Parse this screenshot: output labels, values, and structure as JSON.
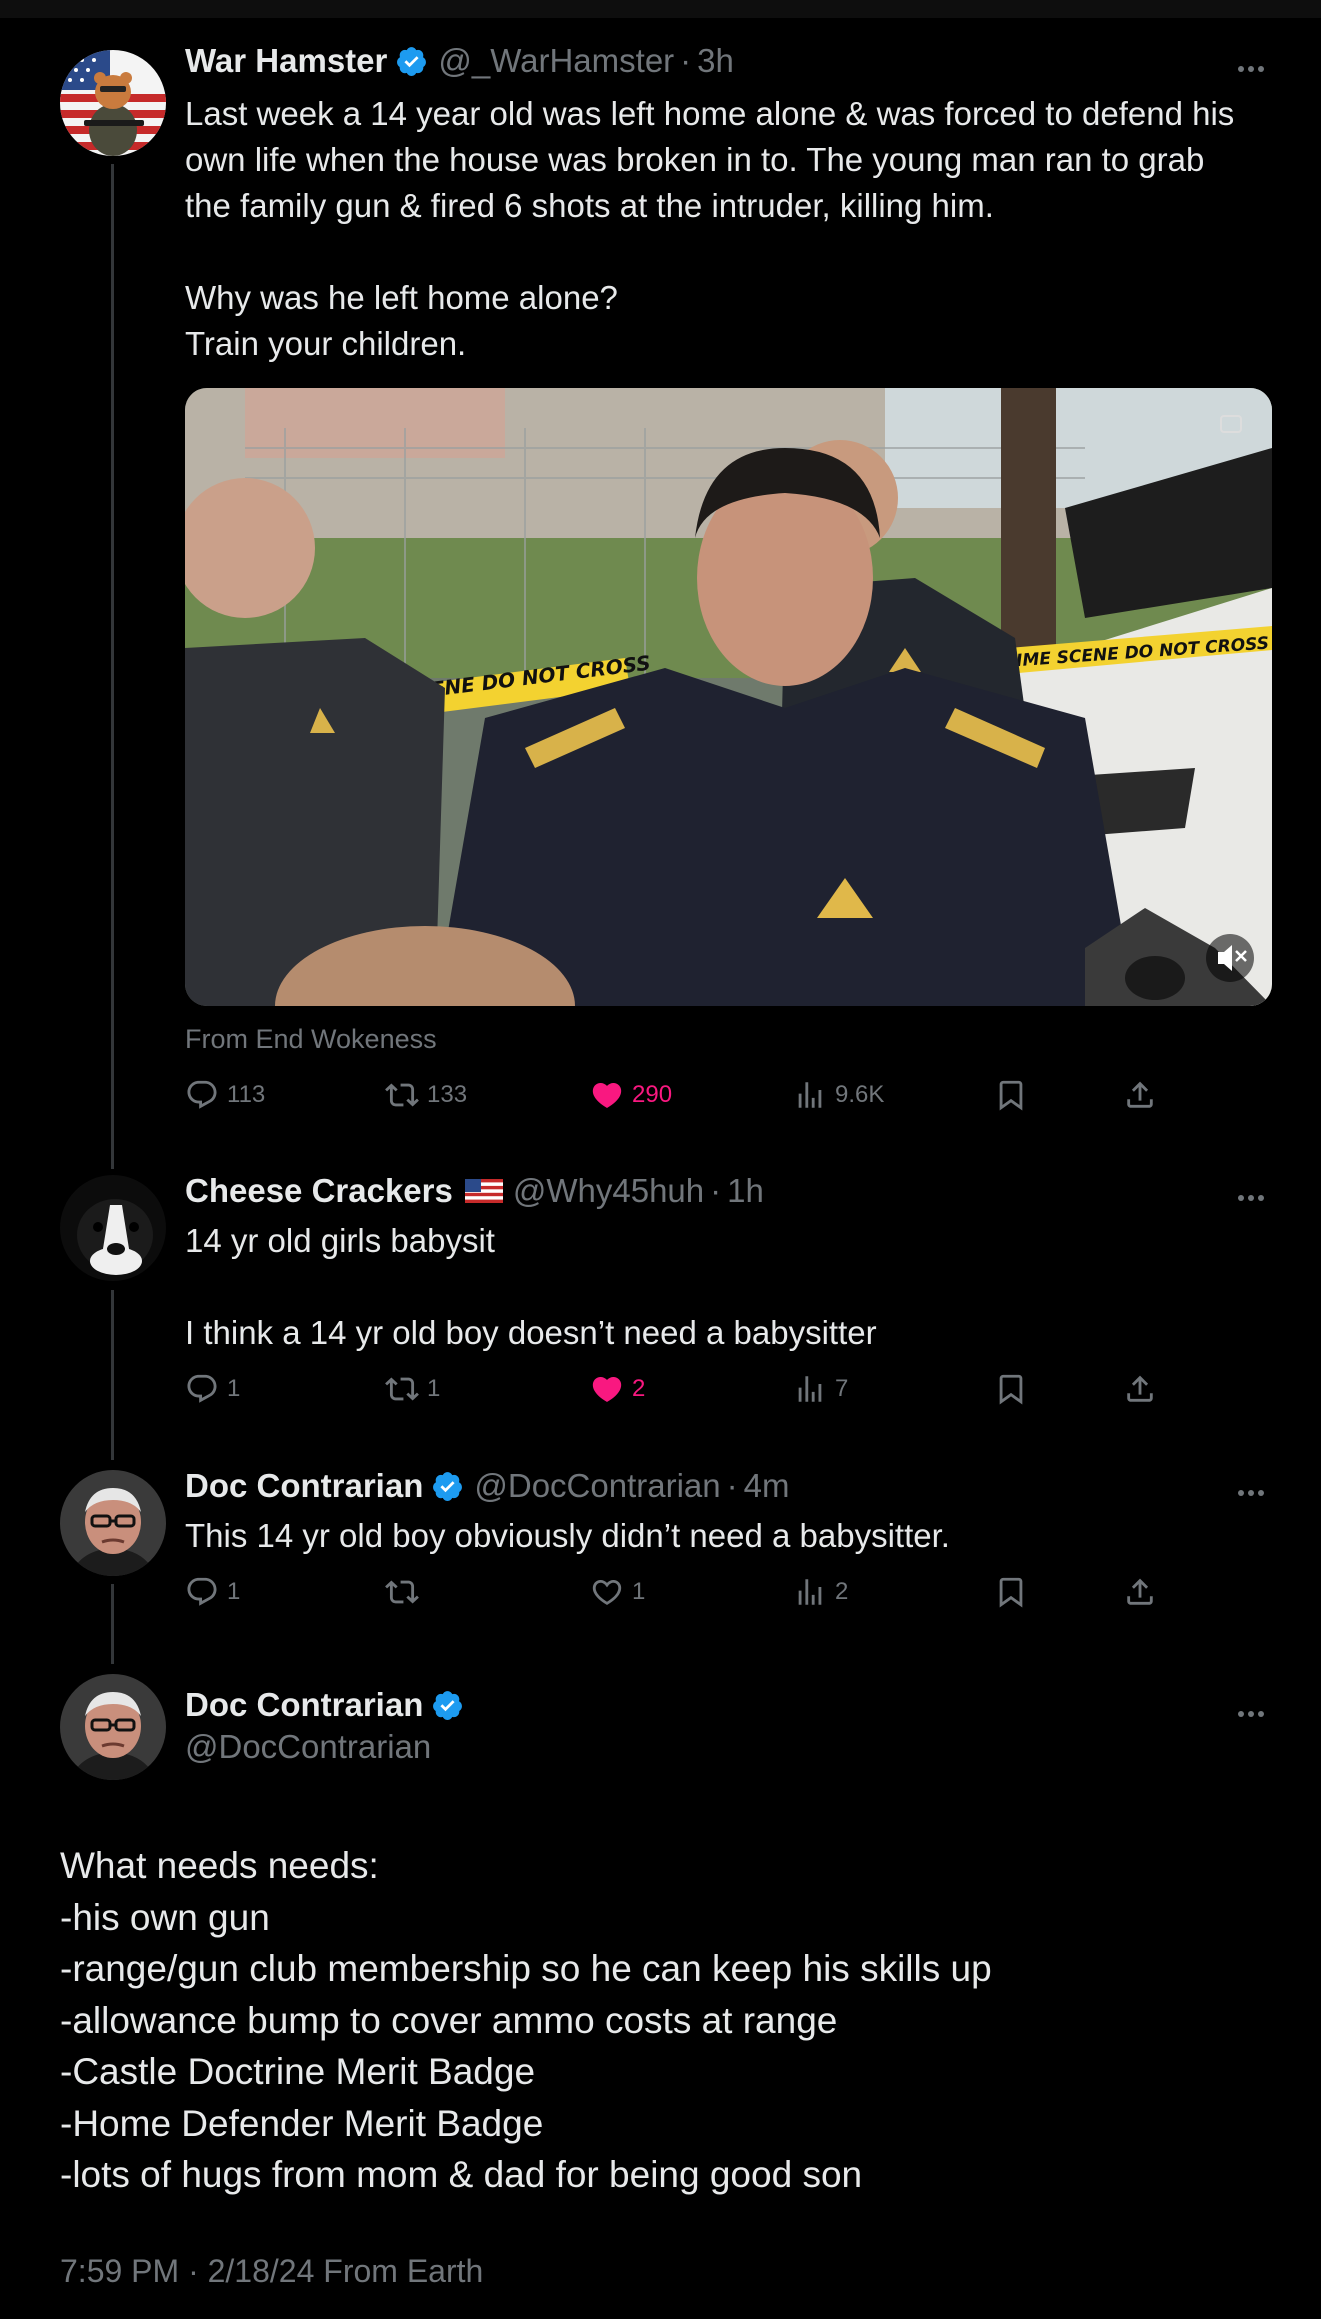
{
  "colors": {
    "background": "#000000",
    "text": "#e7e9ea",
    "muted": "#71767b",
    "like": "#f91880",
    "verified": "#1d9bf0"
  },
  "thread": [
    {
      "name": "War Hamster",
      "handle": "@_WarHamster",
      "time": "3h",
      "verified": true,
      "avatar_icon": "soldier-hamster-avatar",
      "text_lines": [
        "Last week a 14 year old was left home alone & was forced to defend his",
        "own life when the house was broken in to. The young man ran to grab",
        "the family gun & fired 6 shots at the intruder, killing him.",
        "",
        "Why was he left home alone?",
        "Train your children."
      ],
      "media": {
        "tape_left": "SCENE DO NOT CROSS",
        "tape_right": "CRIME SCENE DO NOT CROSS",
        "mute_icon": "mute-icon",
        "cc_icon": "captions-icon"
      },
      "source": "From End Wokeness",
      "stats": {
        "replies": "113",
        "reposts": "133",
        "likes": "290",
        "views": "9.6K"
      },
      "liked": true
    },
    {
      "name": "Cheese Crackers",
      "handle": "@Why45huh",
      "time": "1h",
      "flag_icon": "us-flag-icon",
      "avatar_icon": "dog-avatar",
      "text_lines": [
        "14 yr old girls babysit",
        "",
        "I think a 14 yr old boy doesn’t need a babysitter"
      ],
      "stats": {
        "replies": "1",
        "reposts": "1",
        "likes": "2",
        "views": "7"
      },
      "liked": true
    },
    {
      "name": "Doc Contrarian",
      "handle": "@DocContrarian",
      "time": "4m",
      "verified": true,
      "avatar_icon": "old-man-avatar",
      "text_lines": [
        "This 14 yr old boy obviously didn’t need a babysitter."
      ],
      "stats": {
        "replies": "1",
        "reposts": "",
        "likes": "1",
        "views": "2"
      },
      "liked": false
    }
  ],
  "main_post": {
    "name": "Doc Contrarian",
    "handle": "@DocContrarian",
    "verified": true,
    "avatar_icon": "old-man-avatar",
    "text_lines": [
      "What needs needs:",
      "-his own gun",
      "-range/gun club membership so he can keep his skills up",
      "-allowance bump to cover ammo costs at range",
      "-Castle Doctrine Merit Badge",
      "-Home Defender Merit Badge",
      "-lots of hugs from mom & dad for being good son"
    ],
    "timestamp": "7:59 PM · 2/18/24 From Earth"
  }
}
